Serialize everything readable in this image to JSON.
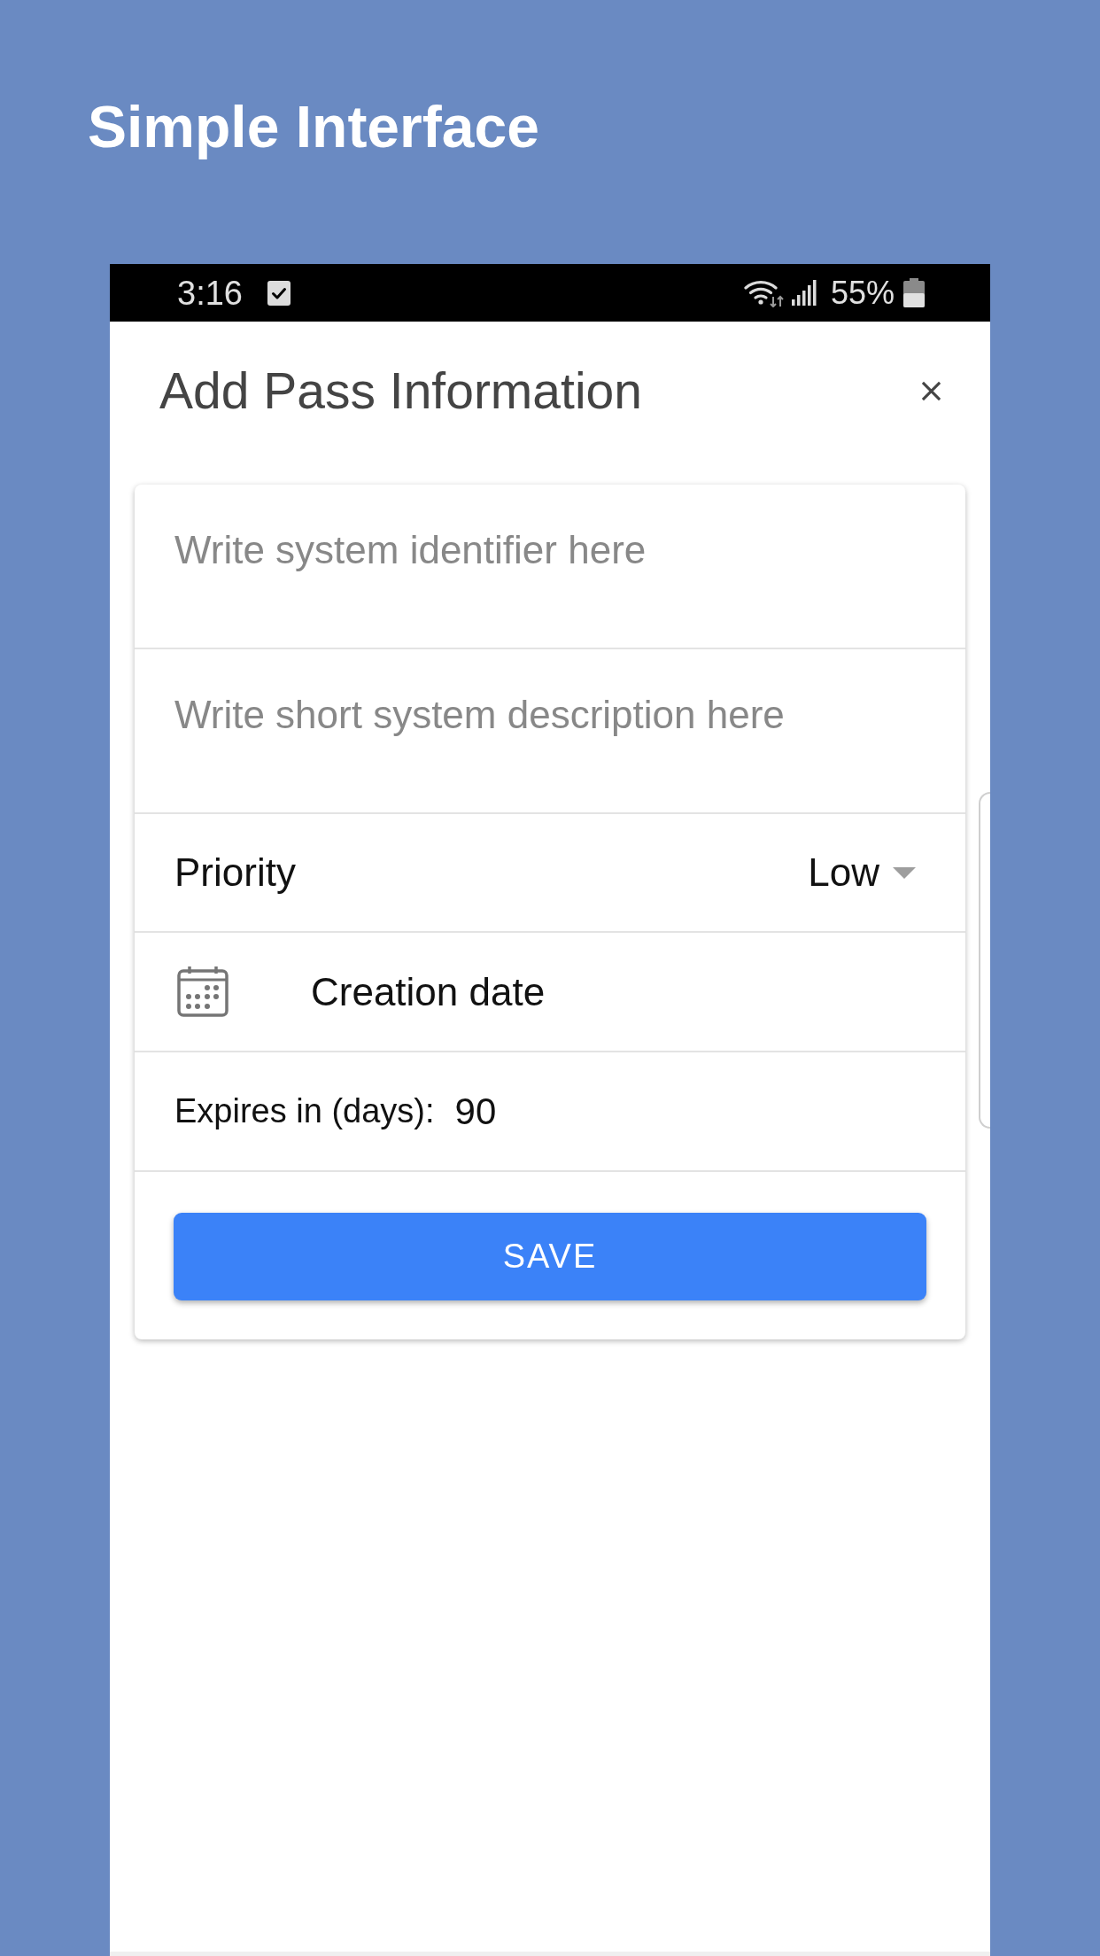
{
  "page_title": "Simple Interface",
  "status_bar": {
    "time": "3:16",
    "battery_text": "55%"
  },
  "dialog": {
    "title": "Add Pass Information",
    "rows": [
      {
        "kind": "text",
        "placeholder": "Write system identifier here"
      },
      {
        "kind": "text",
        "placeholder": "Write short system description here"
      },
      {
        "kind": "select",
        "label": "Priority",
        "value": "Low"
      },
      {
        "kind": "date",
        "label": "Creation date"
      },
      {
        "kind": "number",
        "label": "Expires in (days):",
        "value": "90"
      }
    ],
    "button": "SAVE"
  }
}
